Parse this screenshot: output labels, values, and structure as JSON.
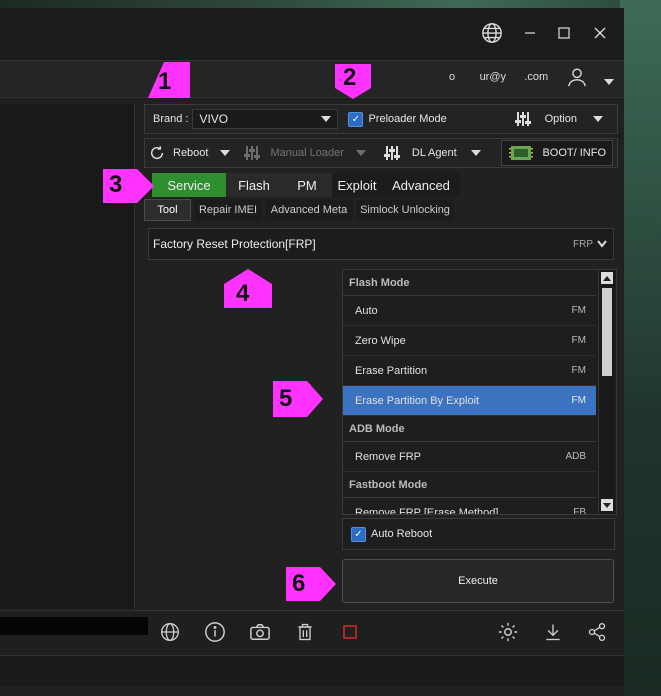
{
  "account": {
    "email": "o        ur@y      .com"
  },
  "toolbar1": {
    "brand_label": "Brand :",
    "brand_value": "VIVO",
    "preloader_label": "Preloader Mode",
    "option_label": "Option"
  },
  "toolbar2": {
    "reboot_label": "Reboot",
    "manual_loader_label": "Manual Loader",
    "dl_agent_label": "DL Agent",
    "boot_info_label": "BOOT/ INFO"
  },
  "tabs": [
    "Service",
    "Flash",
    "PM",
    "Exploit",
    "Advanced"
  ],
  "subtabs": [
    "Tool",
    "Repair IMEI",
    "Advanced Meta",
    "Simlock Unlocking"
  ],
  "function": {
    "title": "Factory Reset Protection[FRP]",
    "tag": "FRP"
  },
  "list": {
    "groups": [
      {
        "header": "Flash Mode"
      },
      {
        "header": "ADB Mode"
      },
      {
        "header": "Fastboot Mode"
      }
    ],
    "items": [
      {
        "label": "Auto",
        "tag": "FM"
      },
      {
        "label": "Zero Wipe",
        "tag": "FM"
      },
      {
        "label": "Erase Partition",
        "tag": "FM"
      },
      {
        "label": "Erase Partition By Exploit",
        "tag": "FM"
      },
      {
        "label": "Remove FRP",
        "tag": "ADB"
      },
      {
        "label": "Remove FRP [Erase Method]",
        "tag": "FB"
      }
    ]
  },
  "auto_reboot_label": "Auto Reboot",
  "execute_label": "Execute",
  "markers": [
    "1",
    "2",
    "3",
    "4",
    "5",
    "6"
  ],
  "colors": {
    "tab_active": "#2f8f2f",
    "selected_row": "#3b73c0",
    "marker": "#ff33ff"
  }
}
